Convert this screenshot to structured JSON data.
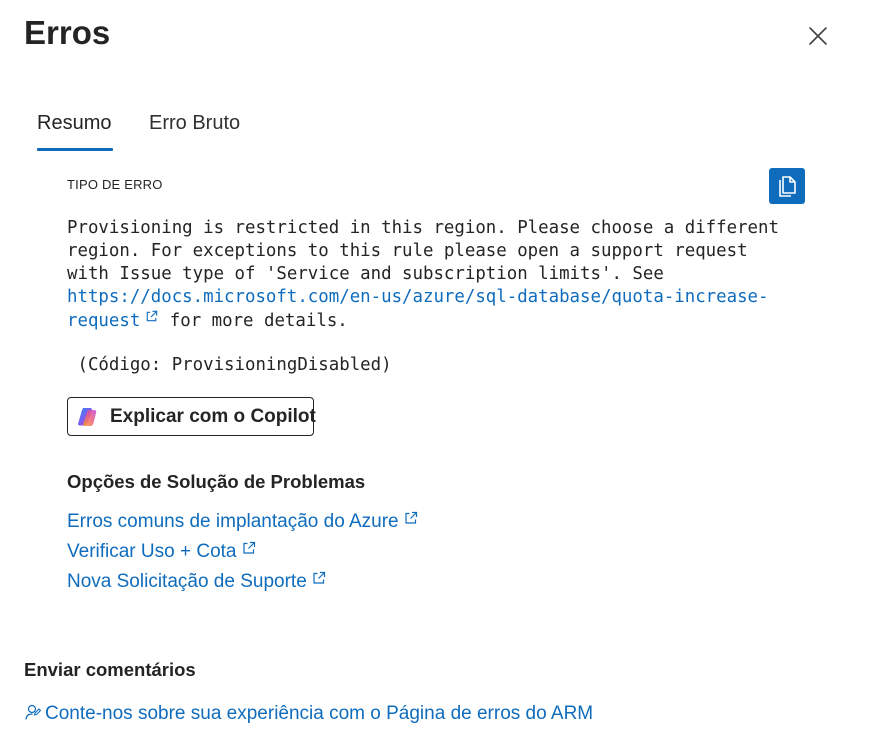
{
  "panel": {
    "title": "Erros",
    "close_icon": "close-icon"
  },
  "tabs": [
    {
      "label": "Resumo",
      "active": true
    },
    {
      "label": "Erro Bruto",
      "active": false
    }
  ],
  "error": {
    "section_label": "TIPO DE ERRO",
    "copy_icon": "copy-icon",
    "message_line1": "Provisioning is restricted in this region. Please choose a different",
    "message_line2": "region. For exceptions to this rule please open a support request",
    "message_line3": "with Issue type of 'Service and subscription limits'. See",
    "link_line1": "https://docs.microsoft.com/en-us/azure/sql-database/quota-increase-",
    "link_line2": "request",
    "message_suffix": " for more details.",
    "code": " (Código: ProvisioningDisabled)"
  },
  "copilot": {
    "label": "Explicar com o Copilot",
    "icon": "copilot-icon"
  },
  "troubleshooting": {
    "title": "Opções de Solução de Problemas",
    "links": [
      {
        "label": "Erros comuns de implantação do Azure"
      },
      {
        "label": "Verificar Uso + Cota"
      },
      {
        "label": "Nova Solicitação de Suporte"
      }
    ]
  },
  "feedback": {
    "title": "Enviar comentários",
    "link_label": "Conte-nos sobre sua experiência com o Página de erros do ARM",
    "icon": "feedback-person-icon"
  },
  "colors": {
    "accent": "#0f6cbd",
    "text": "#242424"
  }
}
